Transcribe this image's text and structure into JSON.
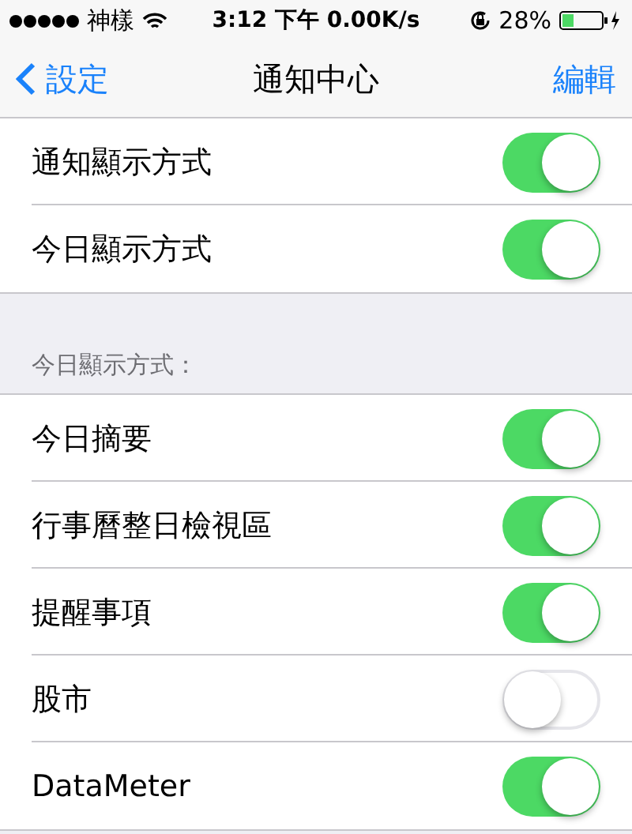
{
  "status_bar": {
    "carrier": "神樣",
    "time": "3:12 下午 0.00K/s",
    "battery": "28%"
  },
  "nav": {
    "back": "設定",
    "title": "通知中心",
    "action": "編輯"
  },
  "groups": [
    {
      "rows": [
        {
          "label": "通知顯示方式",
          "on": true
        },
        {
          "label": "今日顯示方式",
          "on": true
        }
      ]
    },
    {
      "header": "今日顯示方式：",
      "rows": [
        {
          "label": "今日摘要",
          "on": true
        },
        {
          "label": "行事曆整日檢視區",
          "on": true
        },
        {
          "label": "提醒事項",
          "on": true
        },
        {
          "label": "股市",
          "on": false
        },
        {
          "label": "DataMeter",
          "on": true
        }
      ]
    }
  ]
}
